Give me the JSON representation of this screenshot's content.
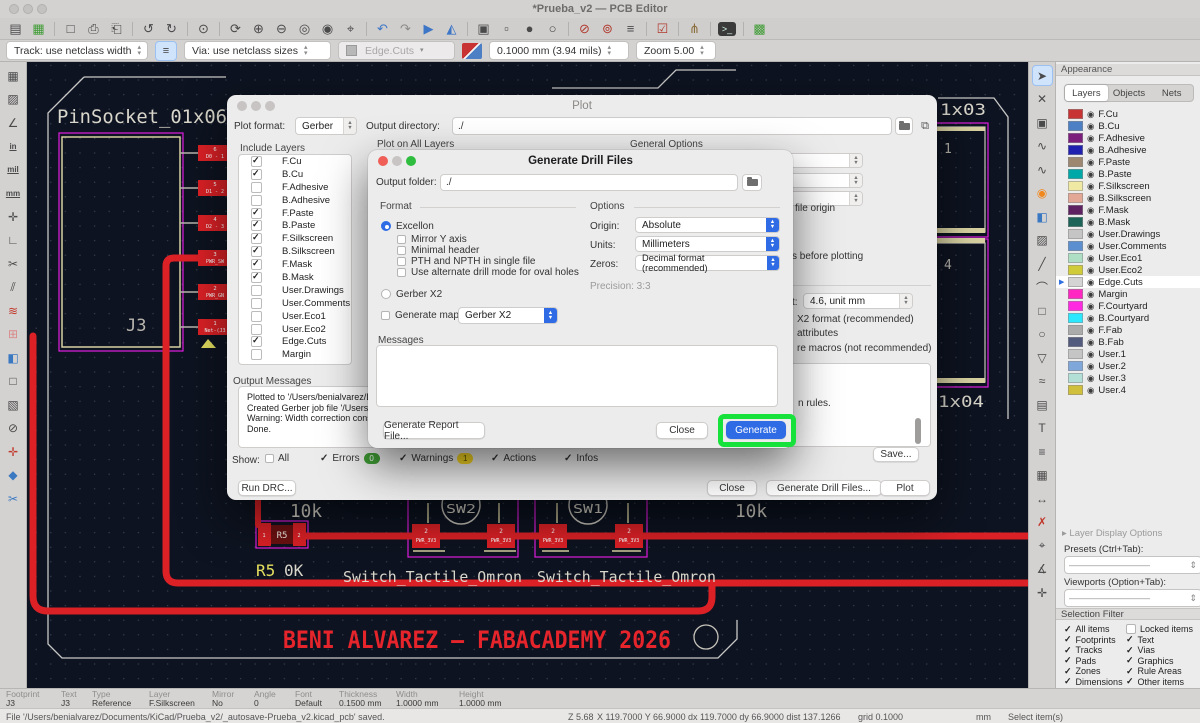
{
  "window": {
    "title": "*Prueba_v2 — PCB Editor"
  },
  "toolbar_top": {
    "icons": [
      {
        "name": "save-icon",
        "glyph": "▤"
      },
      {
        "name": "board-setup-icon",
        "glyph": "▦",
        "color": "#3f9c35"
      },
      {
        "divider": true
      },
      {
        "name": "page-settings-icon",
        "glyph": "□"
      },
      {
        "name": "print-icon",
        "glyph": "⎙"
      },
      {
        "name": "plot-icon",
        "glyph": "⎗"
      },
      {
        "divider": true
      },
      {
        "name": "undo-icon",
        "glyph": "↺"
      },
      {
        "name": "redo-icon",
        "glyph": "↻"
      },
      {
        "divider": true
      },
      {
        "name": "find-icon",
        "glyph": "⊙"
      },
      {
        "divider": true
      },
      {
        "name": "refresh-icon",
        "glyph": "⟳"
      },
      {
        "name": "zoom-in-icon",
        "glyph": "⊕"
      },
      {
        "name": "zoom-out-icon",
        "glyph": "⊖"
      },
      {
        "name": "zoom-fit-icon",
        "glyph": "◎"
      },
      {
        "name": "zoom-to-objects-icon",
        "glyph": "◉"
      },
      {
        "name": "zoom-selection-icon",
        "glyph": "⌖"
      },
      {
        "divider": true
      },
      {
        "name": "rotate-ccw-icon",
        "glyph": "↶",
        "color": "#3d76c6"
      },
      {
        "name": "rotate-cw-icon",
        "glyph": "↷",
        "color": "#8a8a8a"
      },
      {
        "name": "flip-icon",
        "glyph": "▶",
        "color": "#3d76c6"
      },
      {
        "name": "mirror-icon",
        "glyph": "◭",
        "color": "#3d76c6"
      },
      {
        "divider": true
      },
      {
        "name": "group-icon",
        "glyph": "▣"
      },
      {
        "name": "ungroup-icon",
        "glyph": "▫"
      },
      {
        "name": "lock-icon",
        "glyph": "●"
      },
      {
        "name": "unlock-icon",
        "glyph": "○"
      },
      {
        "divider": true
      },
      {
        "name": "footprint-checker-icon",
        "glyph": "⊘",
        "color": "#b03a2e"
      },
      {
        "name": "search-footprints-icon",
        "glyph": "⊚",
        "color": "#b03a2e"
      },
      {
        "name": "layers-manager-icon",
        "glyph": "≡"
      },
      {
        "divider": true
      },
      {
        "name": "drc-icon",
        "glyph": "☑",
        "color": "#b03a2e"
      },
      {
        "divider": true
      },
      {
        "name": "interactive-router-icon",
        "glyph": "⋔",
        "color": "#8a6d3b"
      },
      {
        "divider": true
      },
      {
        "name": "scripting-console-icon",
        "glyph": ">_",
        "console": true
      },
      {
        "divider": true
      },
      {
        "name": "footprint-wizard-icon",
        "glyph": "▩",
        "color": "#3f9c35"
      }
    ]
  },
  "toolbar_second": {
    "track": "Track: use netclass width",
    "track_menu_glyph": "≡",
    "via": "Via: use netclass sizes",
    "layer_combo": "Edge.Cuts",
    "grid": "0.1000 mm (3.94 mils)",
    "zoom": "Zoom 5.00"
  },
  "left_toolbar": {
    "icons": [
      {
        "name": "grid-settings-icon",
        "glyph": "▦"
      },
      {
        "name": "grid-override-icon",
        "glyph": "▨"
      },
      {
        "name": "polar-coordinates-icon",
        "glyph": "∠"
      },
      {
        "name": "units-inches-icon",
        "glyph": "in",
        "unit": true
      },
      {
        "name": "units-mils-icon",
        "glyph": "mil",
        "unit": true
      },
      {
        "name": "units-mm-icon",
        "glyph": "mm",
        "unit": true
      },
      {
        "name": "crosshair-cursor-icon",
        "glyph": "✛"
      },
      {
        "name": "local-coordinates-icon",
        "glyph": "∟"
      },
      {
        "name": "ratsnest-scissors-icon",
        "glyph": "✂"
      },
      {
        "name": "ratsnest-lines-icon",
        "glyph": "⫽"
      },
      {
        "name": "highlight-nets-icon",
        "glyph": "≋",
        "color": "#c0392b"
      },
      {
        "name": "net-color-mode-icon",
        "glyph": "⊞",
        "color": "#d98a8a"
      },
      {
        "name": "zone-fill-icon",
        "glyph": "◧",
        "color": "#3a78c2"
      },
      {
        "name": "zone-outline-icon",
        "glyph": "□"
      },
      {
        "name": "zone-hatch-icon",
        "glyph": "▧"
      },
      {
        "name": "pad-numbers-icon",
        "glyph": "⊘"
      },
      {
        "name": "drawing-sheet-icon",
        "glyph": "✛",
        "color": "#c0392b"
      },
      {
        "name": "appearance-manager-icon",
        "glyph": "◆",
        "color": "#3a78c2"
      },
      {
        "name": "properties-panel-icon",
        "glyph": "✂",
        "color": "#3a78c2"
      }
    ]
  },
  "right_toolbar": {
    "icons": [
      {
        "name": "select-tool-icon",
        "glyph": "➤",
        "active": true
      },
      {
        "name": "highlight-connection-icon",
        "glyph": "✕"
      },
      {
        "name": "add-footprint-icon",
        "glyph": "▣"
      },
      {
        "name": "route-tracks-icon",
        "glyph": "∿"
      },
      {
        "name": "tune-length-icon",
        "glyph": "∿"
      },
      {
        "name": "add-via-icon",
        "glyph": "◉",
        "color": "#f0881e"
      },
      {
        "name": "draw-zone-icon",
        "glyph": "◧",
        "color": "#3a78c2"
      },
      {
        "name": "rule-area-icon",
        "glyph": "▨"
      },
      {
        "name": "draw-line-icon",
        "glyph": "╱"
      },
      {
        "name": "draw-arc-icon",
        "glyph": "⌒"
      },
      {
        "name": "draw-rectangle-icon",
        "glyph": "□"
      },
      {
        "name": "draw-circle-icon",
        "glyph": "○"
      },
      {
        "name": "draw-polygon-icon",
        "glyph": "▽"
      },
      {
        "name": "draw-spline-icon",
        "glyph": "≈"
      },
      {
        "name": "add-image-icon",
        "glyph": "▤"
      },
      {
        "name": "add-text-icon",
        "glyph": "T"
      },
      {
        "name": "add-textbox-icon",
        "glyph": "≡"
      },
      {
        "name": "add-table-icon",
        "glyph": "▦"
      },
      {
        "name": "add-dimension-icon",
        "glyph": "↔"
      },
      {
        "name": "delete-tool-icon",
        "glyph": "✗",
        "color": "#c0392b"
      },
      {
        "name": "drill-origin-icon",
        "glyph": "⌖"
      },
      {
        "name": "measure-tool-icon",
        "glyph": "∡"
      },
      {
        "name": "grid-origin-icon",
        "glyph": "✛"
      }
    ]
  },
  "appearance": {
    "title": "Appearance",
    "tabs": [
      {
        "label": "Layers",
        "active": true
      },
      {
        "label": "Objects",
        "active": false
      },
      {
        "label": "Nets",
        "active": false
      }
    ],
    "layers": [
      {
        "name": "F.Cu",
        "color": "#C83434"
      },
      {
        "name": "B.Cu",
        "color": "#4D7FC4"
      },
      {
        "name": "F.Adhesive",
        "color": "#7C1E7C"
      },
      {
        "name": "B.Adhesive",
        "color": "#2121B0"
      },
      {
        "name": "F.Paste",
        "color": "#9E8771"
      },
      {
        "name": "B.Paste",
        "color": "#00A8A8"
      },
      {
        "name": "F.Silkscreen",
        "color": "#EFE9A4"
      },
      {
        "name": "B.Silkscreen",
        "color": "#E3A795"
      },
      {
        "name": "F.Mask",
        "color": "#5E2161"
      },
      {
        "name": "B.Mask",
        "color": "#1C6358"
      },
      {
        "name": "User.Drawings",
        "color": "#C5C5C5"
      },
      {
        "name": "User.Comments",
        "color": "#5B8FD0"
      },
      {
        "name": "User.Eco1",
        "color": "#AEDFC5"
      },
      {
        "name": "User.Eco2",
        "color": "#D0CB38"
      },
      {
        "name": "Edge.Cuts",
        "color": "#D4D4D4",
        "selected": true
      },
      {
        "name": "Margin",
        "color": "#FF26C2"
      },
      {
        "name": "F.Courtyard",
        "color": "#FF29E1"
      },
      {
        "name": "B.Courtyard",
        "color": "#2BE8FF"
      },
      {
        "name": "F.Fab",
        "color": "#ABABAB"
      },
      {
        "name": "B.Fab",
        "color": "#525B7E"
      },
      {
        "name": "User.1",
        "color": "#C5C5C5"
      },
      {
        "name": "User.2",
        "color": "#7FA7DA"
      },
      {
        "name": "User.3",
        "color": "#B2DFD6"
      },
      {
        "name": "User.4",
        "color": "#CFBF3A"
      }
    ],
    "layer_display_options": "Layer Display Options",
    "presets_label": "Presets (Ctrl+Tab):",
    "viewports_label": "Viewports (Option+Tab):",
    "selection_filter": {
      "title": "Selection Filter",
      "items": [
        {
          "label": "All items",
          "checked": true
        },
        {
          "label": "Locked items",
          "checked": false
        },
        {
          "label": "Footprints",
          "checked": true
        },
        {
          "label": "Text",
          "checked": true
        },
        {
          "label": "Tracks",
          "checked": true
        },
        {
          "label": "Vias",
          "checked": true
        },
        {
          "label": "Pads",
          "checked": true
        },
        {
          "label": "Graphics",
          "checked": true
        },
        {
          "label": "Zones",
          "checked": true
        },
        {
          "label": "Rule Areas",
          "checked": true
        },
        {
          "label": "Dimensions",
          "checked": true
        },
        {
          "label": "Other items",
          "checked": true
        }
      ]
    }
  },
  "plot_dialog": {
    "title": "Plot",
    "plot_format_label": "Plot format:",
    "plot_format_value": "Gerber",
    "output_dir_label": "Output directory:",
    "output_dir_value": "./",
    "include_layers_label": "Include Layers",
    "include_layers": [
      {
        "name": "F.Cu",
        "checked": true
      },
      {
        "name": "B.Cu",
        "checked": true
      },
      {
        "name": "F.Adhesive",
        "checked": false
      },
      {
        "name": "B.Adhesive",
        "checked": false
      },
      {
        "name": "F.Paste",
        "checked": true
      },
      {
        "name": "B.Paste",
        "checked": true
      },
      {
        "name": "F.Silkscreen",
        "checked": true
      },
      {
        "name": "B.Silkscreen",
        "checked": true
      },
      {
        "name": "F.Mask",
        "checked": true
      },
      {
        "name": "B.Mask",
        "checked": true
      },
      {
        "name": "User.Drawings",
        "checked": false
      },
      {
        "name": "User.Comments",
        "checked": false
      },
      {
        "name": "User.Eco1",
        "checked": false
      },
      {
        "name": "User.Eco2",
        "checked": false
      },
      {
        "name": "Edge.Cuts",
        "checked": true
      },
      {
        "name": "Margin",
        "checked": false
      }
    ],
    "plot_on_all_layers_label": "Plot on All Layers",
    "general_options_label": "General Options",
    "fragments": {
      "file_origin": "file origin",
      "before_plotting": "s before plotting",
      "coord_label": "t:",
      "coord_value": "4.6, unit mm",
      "x2_format": "X2 format (recommended)",
      "attributes": "attributes",
      "aperture_macros": "re macros (not recommended)",
      "rules": "n rules."
    },
    "output_messages_label": "Output Messages",
    "messages": [
      "Plotted to '/Users/benialvarez/D",
      "Created Gerber job file '/Users/",
      "Warning: Width correction cons",
      "Done."
    ],
    "show_label": "Show:",
    "show_filters": [
      {
        "label": "All",
        "checked": false
      },
      {
        "label": "Errors",
        "checked": true,
        "badge": "0",
        "badge_color": "#3f9c35"
      },
      {
        "label": "Warnings",
        "checked": true,
        "badge": "1",
        "badge_color": "#f5d523",
        "badge_text": "#5a5200"
      },
      {
        "label": "Actions",
        "checked": true
      },
      {
        "label": "Infos",
        "checked": true
      }
    ],
    "buttons": {
      "run_drc": "Run DRC...",
      "save": "Save...",
      "close": "Close",
      "generate_drill": "Generate Drill Files...",
      "plot": "Plot"
    }
  },
  "drill_dialog": {
    "title": "Generate Drill Files",
    "output_folder_label": "Output folder:",
    "output_folder_value": "./",
    "format_label": "Format",
    "excellon_label": "Excellon",
    "excellon_checks": [
      "Mirror Y axis",
      "Minimal header",
      "PTH and NPTH in single file",
      "Use alternate drill mode for oval holes"
    ],
    "gerberx2_label": "Gerber X2",
    "generate_map_label": "Generate map:",
    "generate_map_value": "Gerber X2",
    "options_label": "Options",
    "origin_label": "Origin:",
    "origin_value": "Absolute",
    "units_label": "Units:",
    "units_value": "Millimeters",
    "zeros_label": "Zeros:",
    "zeros_value": "Decimal format (recommended)",
    "precision_label": "Precision: 3:3",
    "messages_label": "Messages",
    "buttons": {
      "report": "Generate Report File...",
      "close": "Close",
      "generate": "Generate"
    }
  },
  "properties_bar": {
    "fields": [
      {
        "label": "Footprint",
        "value": "J3",
        "w": 55
      },
      {
        "label": "Text",
        "value": "J3",
        "w": 31
      },
      {
        "label": "Type",
        "value": "Reference",
        "w": 57
      },
      {
        "label": "Layer",
        "value": "F.Silkscreen",
        "w": 63
      },
      {
        "label": "Mirror",
        "value": "No",
        "w": 42
      },
      {
        "label": "Angle",
        "value": "0",
        "w": 41
      },
      {
        "label": "Font",
        "value": "Default",
        "w": 44
      },
      {
        "label": "Thickness",
        "value": "0.1500 mm",
        "w": 57
      },
      {
        "label": "Width",
        "value": "1.0000 mm",
        "w": 63
      },
      {
        "label": "Height",
        "value": "1.0000 mm",
        "w": 63
      }
    ]
  },
  "status_bar": {
    "file_message": "File '/Users/benialvarez/Documents/KiCad/Prueba_v2/_autosave-Prueba_v2.kicad_pcb' saved.",
    "zoom": "Z 5.68",
    "cursor": "X 119.7000  Y 66.9000",
    "delta": "dx 119.7000  dy 66.9000  dist 137.1266",
    "grid": "grid 0.1000",
    "units": "mm",
    "hint": "Select item(s)"
  },
  "pcb": {
    "labels": {
      "pinsocket": "PinSocket_01x06",
      "j3": "J3",
      "r10k_left": "10k",
      "r10k_right": "10k",
      "r5_ref": "R5",
      "r5_body": "R5",
      "r5_val": "0K",
      "sw2": "SW2",
      "sw1": "SW1",
      "switch_name_1": "Switch_Tactile_Omron",
      "switch_name_2": "Switch_Tactile_Omron",
      "banner": "BENI ALVAREZ — FABACADEMY 2026",
      "conn_1x03": "1x03",
      "conn_1x04": "1x04",
      "pin1": "1",
      "pin4": "4"
    },
    "j3_pads": [
      {
        "num": "6",
        "net": "D0 - 1"
      },
      {
        "num": "5",
        "net": "D1 - 2"
      },
      {
        "num": "4",
        "net": "D2 - 3"
      },
      {
        "num": "3",
        "net": "PWR_SW"
      },
      {
        "num": "2",
        "net": "PWR_GN"
      },
      {
        "num": "1",
        "net": "Net-(J3"
      }
    ],
    "r5_pads": [
      {
        "num": "1"
      },
      {
        "num": "2"
      }
    ],
    "sw_pads": [
      {
        "num": "2",
        "net": "PWR_3V3"
      },
      {
        "num": "2",
        "net": "PWR_3V3"
      },
      {
        "num": "2",
        "net": "PWR_3V3"
      },
      {
        "num": "2",
        "net": "PWR_3V3"
      }
    ]
  },
  "colors": {
    "canvas_bg": "#0d1320",
    "trace_red": "#dc2126",
    "courtyard_magenta": "#e21ee2",
    "silkscreen": "#d9d6cb",
    "fab_yellow": "#d8d2a2",
    "edge_gray": "#c8c8c6",
    "banner_red": "#e5242b",
    "highlight_green": "#17e23c",
    "accent_blue": "#2e6be5"
  }
}
